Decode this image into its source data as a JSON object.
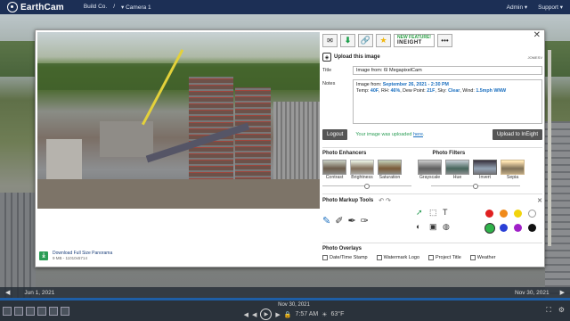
{
  "nav": {
    "logo": "EarthCam",
    "crumb1": "Build Co.",
    "sep": "/",
    "crumb2": "Camera 1",
    "crumb2_caret": "▾",
    "admin": "Admin ▾",
    "support": "Support ▾"
  },
  "modal": {
    "close": "✕",
    "download_title": "Download Full Size Panorama",
    "download_meta": "9 MB - 11010x5714",
    "toolbar": {
      "feature_line1": "NEW FEATURE!",
      "feature_line2": "INEIGHT",
      "more": "•••"
    },
    "upload": {
      "title": "Upload this image",
      "code": "JOMESV"
    },
    "title_label": "Title",
    "title_value": "Image from: 6I MegapixelCam",
    "notes_label": "Notes",
    "notes": {
      "prefix": "Image from: ",
      "date": "September 26, 2021 - 2:30 PM",
      "temp_label": "Temp: ",
      "temp": "40F",
      "rh_label": ", RH: ",
      "rh": "46%",
      "dew_label": ", Dew Point: ",
      "dew": "21F",
      "sky_label": ", Sky: ",
      "sky": "Clear",
      "wind_label": ", Wind: ",
      "wind": "1.5mph WNW"
    },
    "logout": "Logout",
    "uploaded_prefix": "Your image was uploaded ",
    "uploaded_link": "here",
    "uploaded_suffix": ".",
    "upload_btn": "Upload to InEight",
    "enhancers_title": "Photo Enhancers",
    "filters_title": "Photo Filters",
    "enhancers": [
      "Contrast",
      "Brightness",
      "Saturation"
    ],
    "filters": [
      "Grayscale",
      "Hue",
      "Invert",
      "Sepia"
    ],
    "markup_title": "Photo Markup Tools",
    "markup_undo": "↶ ↷",
    "markup_close": "✕",
    "colors": [
      "#e02020",
      "#f08a1a",
      "#f2d40c",
      "#ffffff",
      "#2fb34a",
      "#2a3fd6",
      "#a020c8",
      "#111111"
    ],
    "overlay_title": "Photo Overlays",
    "overlays": [
      "Date/Time Stamp",
      "Watermark Logo",
      "Project Title",
      "Weather"
    ]
  },
  "timeline": {
    "from": "Jun 1, 2021",
    "to": "Nov 30, 2021",
    "left_arrow": "◀",
    "right_arrow": "▶"
  },
  "player": {
    "date": "Nov 30, 2021",
    "time": "7:57 AM",
    "temp": "63°F"
  }
}
